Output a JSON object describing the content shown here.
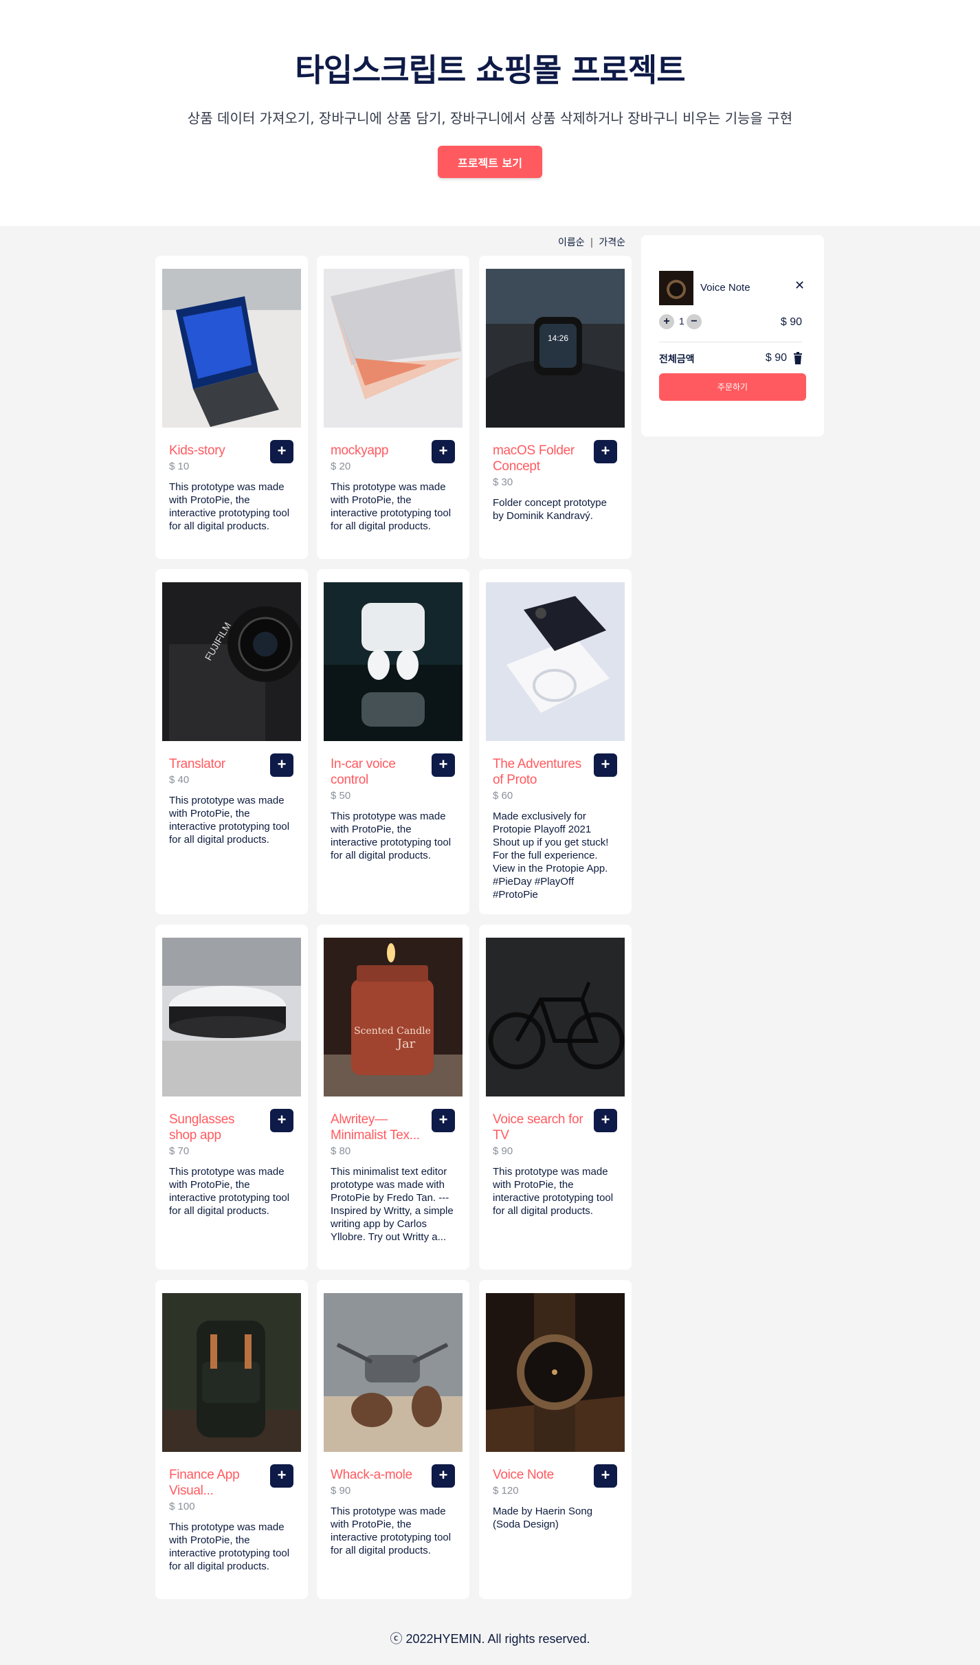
{
  "hero": {
    "title": "타입스크립트 쇼핑몰 프로젝트",
    "subtitle": "상품 데이터 가져오기, 장바구니에 상품 담기, 장바구니에서 상품 삭제하거나 장바구니 비우는 기능을 구현",
    "button_label": "프로젝트 보기"
  },
  "sort": {
    "by_name": "이름순",
    "separator": "|",
    "by_price": "가격순"
  },
  "products": [
    {
      "name": "Kids-story",
      "price": "$ 10",
      "desc": "This prototype was made with ProtoPie, the interactive prototyping tool for all digital products.",
      "icon": "tablet-icon"
    },
    {
      "name": "mockyapp",
      "price": "$ 20",
      "desc": "This prototype was made with ProtoPie, the interactive prototyping tool for all digital products.",
      "icon": "laptop-icon"
    },
    {
      "name": "macOS Folder Concept",
      "price": "$ 30",
      "desc": "Folder concept prototype by Dominik Kandravý.",
      "icon": "smartwatch-icon"
    },
    {
      "name": "Translator",
      "price": "$ 40",
      "desc": "This prototype was made with ProtoPie, the interactive prototyping tool for all digital products.",
      "icon": "camera-icon"
    },
    {
      "name": "In-car voice control",
      "price": "$ 50",
      "desc": "This prototype was made with ProtoPie, the interactive prototyping tool for all digital products.",
      "icon": "earbuds-icon"
    },
    {
      "name": "The Adventures of Proto",
      "price": "$ 60",
      "desc": "Made exclusively for Protopie Playoff 2021 Shout up if you get stuck! For the full experience. View in the Protopie App. #PieDay #PlayOff #ProtoPie",
      "icon": "phone-icon"
    },
    {
      "name": "Sunglasses shop app",
      "price": "$ 70",
      "desc": "This prototype was made with ProtoPie, the interactive prototyping tool for all digital products.",
      "icon": "robot-vacuum-icon"
    },
    {
      "name": "Alwritey—Minimalist Tex...",
      "price": "$ 80",
      "desc": "This minimalist text editor prototype was made with ProtoPie by Fredo Tan. --- Inspired by Writty, a simple writing app by Carlos Yllobre. Try out Writty a...",
      "icon": "candle-icon"
    },
    {
      "name": "Voice search for TV",
      "price": "$ 90",
      "desc": "This prototype was made with ProtoPie, the interactive prototyping tool for all digital products.",
      "icon": "bicycle-icon"
    },
    {
      "name": "Finance App Visual...",
      "price": "$ 100",
      "desc": "This prototype was made with ProtoPie, the interactive prototyping tool for all digital products.",
      "icon": "backpack-icon"
    },
    {
      "name": "Whack-a-mole",
      "price": "$ 90",
      "desc": "This prototype was made with ProtoPie, the interactive prototyping tool for all digital products.",
      "icon": "drone-icon"
    },
    {
      "name": "Voice Note",
      "price": "$ 120",
      "desc": "Made by Haerin Song (Soda Design)",
      "icon": "wristwatch-icon"
    }
  ],
  "add_label": "+",
  "cart": {
    "item_name": "Voice Note",
    "remove_label": "✕",
    "plus_label": "+",
    "quantity": "1",
    "minus_label": "−",
    "line_price": "$ 90",
    "total_label": "전체금액",
    "total_value": "$ 90",
    "order_label": "주문하기"
  },
  "footer": {
    "text": "ⓒ 2022HYEMIN. All rights reserved."
  },
  "colors": {
    "accent": "#ff5a5f",
    "navy": "#0e1a47",
    "background": "#f4f4f4"
  }
}
